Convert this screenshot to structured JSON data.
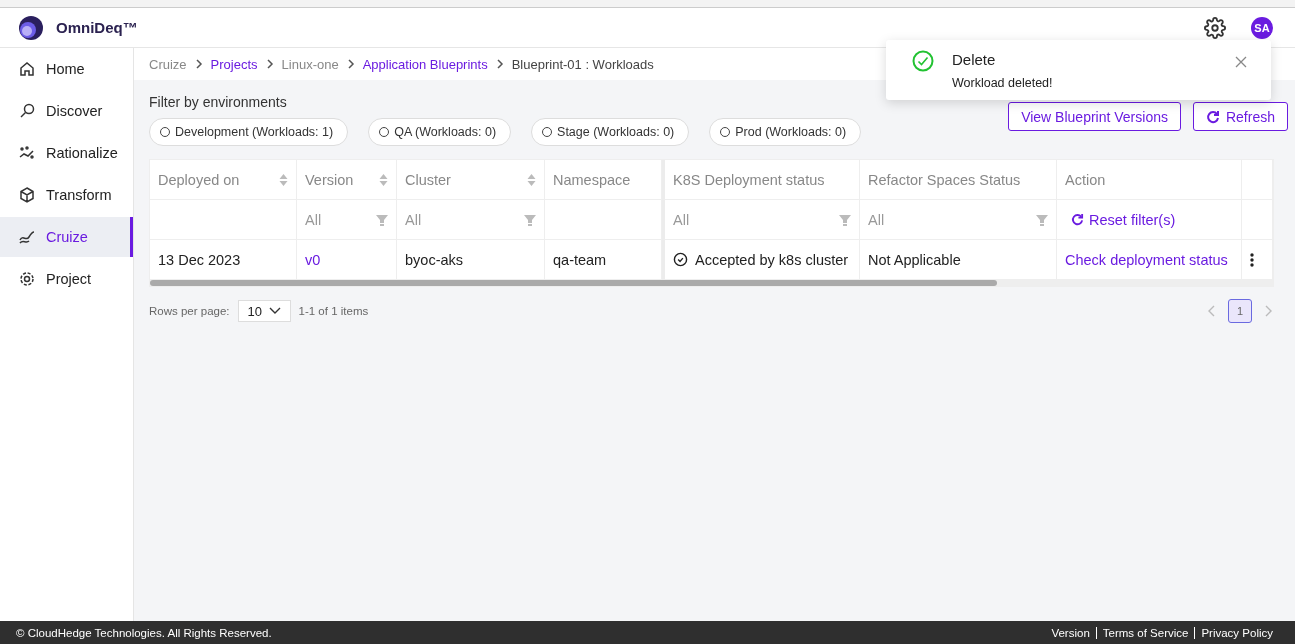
{
  "app": {
    "name": "OmniDeq™",
    "avatar": "SA"
  },
  "sidebar": {
    "items": [
      {
        "label": "Home",
        "selected": false
      },
      {
        "label": "Discover",
        "selected": false
      },
      {
        "label": "Rationalize",
        "selected": false
      },
      {
        "label": "Transform",
        "selected": false
      },
      {
        "label": "Cruize",
        "selected": true
      },
      {
        "label": "Project",
        "selected": false
      }
    ]
  },
  "breadcrumb": [
    {
      "label": "Cruize",
      "link": false
    },
    {
      "label": "Projects",
      "link": true
    },
    {
      "label": "Linux-one",
      "link": false
    },
    {
      "label": "Application Blueprints",
      "link": true
    },
    {
      "label": "Blueprint-01 : Workloads",
      "link": false
    }
  ],
  "filter": {
    "title": "Filter by environments",
    "chips": [
      {
        "label": "Development (Workloads: 1)",
        "selected": false
      },
      {
        "label": "QA (Workloads: 0)",
        "selected": false
      },
      {
        "label": "Stage (Workloads: 0)",
        "selected": false
      },
      {
        "label": "Prod (Workloads: 0)",
        "selected": false
      }
    ]
  },
  "actions": [
    {
      "label": "View Blueprint Versions",
      "kind": "plain"
    },
    {
      "label": "Refresh",
      "kind": "refresh"
    }
  ],
  "table": {
    "columns": [
      {
        "label": "Deployed on",
        "sortable": true
      },
      {
        "label": "Version",
        "sortable": true
      },
      {
        "label": "Cluster",
        "sortable": true
      },
      {
        "label": "Namespace",
        "sortable": false
      },
      {
        "label": "K8S Deployment status",
        "sortable": false
      },
      {
        "label": "Refactor Spaces Status",
        "sortable": false
      },
      {
        "label": "Action",
        "sortable": false
      }
    ],
    "filters": [
      {
        "kind": "empty"
      },
      {
        "kind": "select",
        "value": "All"
      },
      {
        "kind": "select",
        "value": "All"
      },
      {
        "kind": "empty"
      },
      {
        "kind": "select",
        "value": "All"
      },
      {
        "kind": "select",
        "value": "All"
      },
      {
        "kind": "reset",
        "label": "Reset filter(s)"
      }
    ],
    "rows": [
      {
        "cells": [
          {
            "kind": "text",
            "text": "13 Dec 2023"
          },
          {
            "kind": "link",
            "text": "v0"
          },
          {
            "kind": "text",
            "text": "byoc-aks"
          },
          {
            "kind": "text",
            "text": "qa-team"
          },
          {
            "kind": "status",
            "text": "Accepted by k8s cluster"
          },
          {
            "kind": "text",
            "text": "Not Applicable"
          },
          {
            "kind": "link",
            "text": "Check deployment status"
          }
        ]
      }
    ]
  },
  "pagination": {
    "rows_label": "Rows per page:",
    "page_size": "10",
    "range": "1-1 of 1 items",
    "pages": [
      {
        "label": "1",
        "selected": true
      }
    ]
  },
  "toast": {
    "title": "Delete",
    "message": "Workload deleted!"
  },
  "footer": {
    "copyright": "© CloudHedge Technologies. All Rights Reserved.",
    "links": [
      "Version",
      "Terms of Service",
      "Privacy Policy"
    ]
  }
}
